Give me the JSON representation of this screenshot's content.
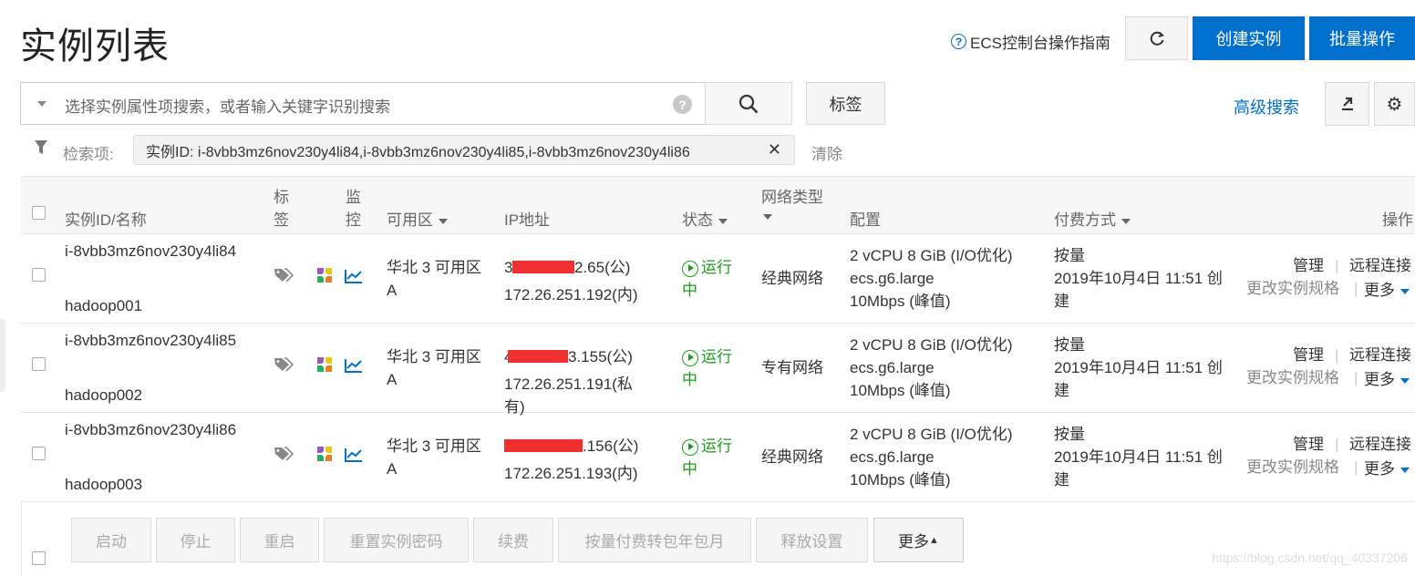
{
  "page": {
    "title": "实例列表",
    "guide_label": "ECS控制台操作指南",
    "create_label": "创建实例",
    "batch_label": "批量操作"
  },
  "search": {
    "placeholder": "选择实例属性项搜索，或者输入关键字识别搜索",
    "tag_button": "标签",
    "advanced": "高级搜索"
  },
  "filter": {
    "label": "检索项:",
    "chip": "实例ID: i-8vbb3mz6nov230y4li84,i-8vbb3mz6nov230y4li85,i-8vbb3mz6nov230y4li86",
    "clear": "清除"
  },
  "table": {
    "headers": {
      "id_name": "实例ID/名称",
      "tag_1": "标",
      "tag_2": "签",
      "monitor_1": "监",
      "monitor_2": "控",
      "zone": "可用区",
      "ip": "IP地址",
      "status": "状态",
      "network": "网络类型",
      "config": "配置",
      "billing": "付费方式",
      "ops": "操作"
    },
    "rows": [
      {
        "id": "i-8vbb3mz6nov230y4li84",
        "name": "hadoop001",
        "zone_1": "华北 3 可用区",
        "zone_2": "A",
        "ip_public_prefix": "3",
        "ip_public_suffix": "2.65(公)",
        "ip_private_1": "172.26.251.192(内)",
        "ip_private_2": "",
        "status_1": "运行",
        "status_2": "中",
        "network": "经典网络",
        "config_1": "2 vCPU 8 GiB (I/O优化)",
        "config_2": "ecs.g6.large",
        "config_3": "10Mbps (峰值)",
        "billing_1": "按量",
        "billing_2": "2019年10月4日 11:51 创",
        "billing_3": "建",
        "manage": "管理",
        "remote": "远程连接",
        "resize": "更改实例规格",
        "more": "更多"
      },
      {
        "id": "i-8vbb3mz6nov230y4li85",
        "name": "hadoop002",
        "zone_1": "华北 3 可用区",
        "zone_2": "A",
        "ip_public_prefix": "4",
        "ip_public_suffix": "3.155(公)",
        "ip_private_1": "172.26.251.191(私",
        "ip_private_2": "有)",
        "status_1": "运行",
        "status_2": "中",
        "network": "专有网络",
        "config_1": "2 vCPU 8 GiB (I/O优化)",
        "config_2": "ecs.g6.large",
        "config_3": "10Mbps (峰值)",
        "billing_1": "按量",
        "billing_2": "2019年10月4日 11:51 创",
        "billing_3": "建",
        "manage": "管理",
        "remote": "远程连接",
        "resize": "更改实例规格",
        "more": "更多"
      },
      {
        "id": "i-8vbb3mz6nov230y4li86",
        "name": "hadoop003",
        "zone_1": "华北 3 可用区",
        "zone_2": "A",
        "ip_public_prefix": "",
        "ip_public_suffix": ".156(公)",
        "ip_private_1": "172.26.251.193(内)",
        "ip_private_2": "",
        "status_1": "运行",
        "status_2": "中",
        "network": "经典网络",
        "config_1": "2 vCPU 8 GiB (I/O优化)",
        "config_2": "ecs.g6.large",
        "config_3": "10Mbps (峰值)",
        "billing_1": "按量",
        "billing_2": "2019年10月4日 11:51 创",
        "billing_3": "建",
        "manage": "管理",
        "remote": "远程连接",
        "resize": "更改实例规格",
        "more": "更多"
      }
    ]
  },
  "bulk": {
    "start": "启动",
    "stop": "停止",
    "restart": "重启",
    "reset_pwd": "重置实例密码",
    "renew": "续费",
    "convert": "按量付费转包年包月",
    "release": "释放设置",
    "more": "更多"
  },
  "watermark": "https://blog.csdn.net/qq_40337206",
  "colors": {
    "accent": "#0070cc",
    "running": "#1a9e1a",
    "redaction": "#f03030"
  }
}
